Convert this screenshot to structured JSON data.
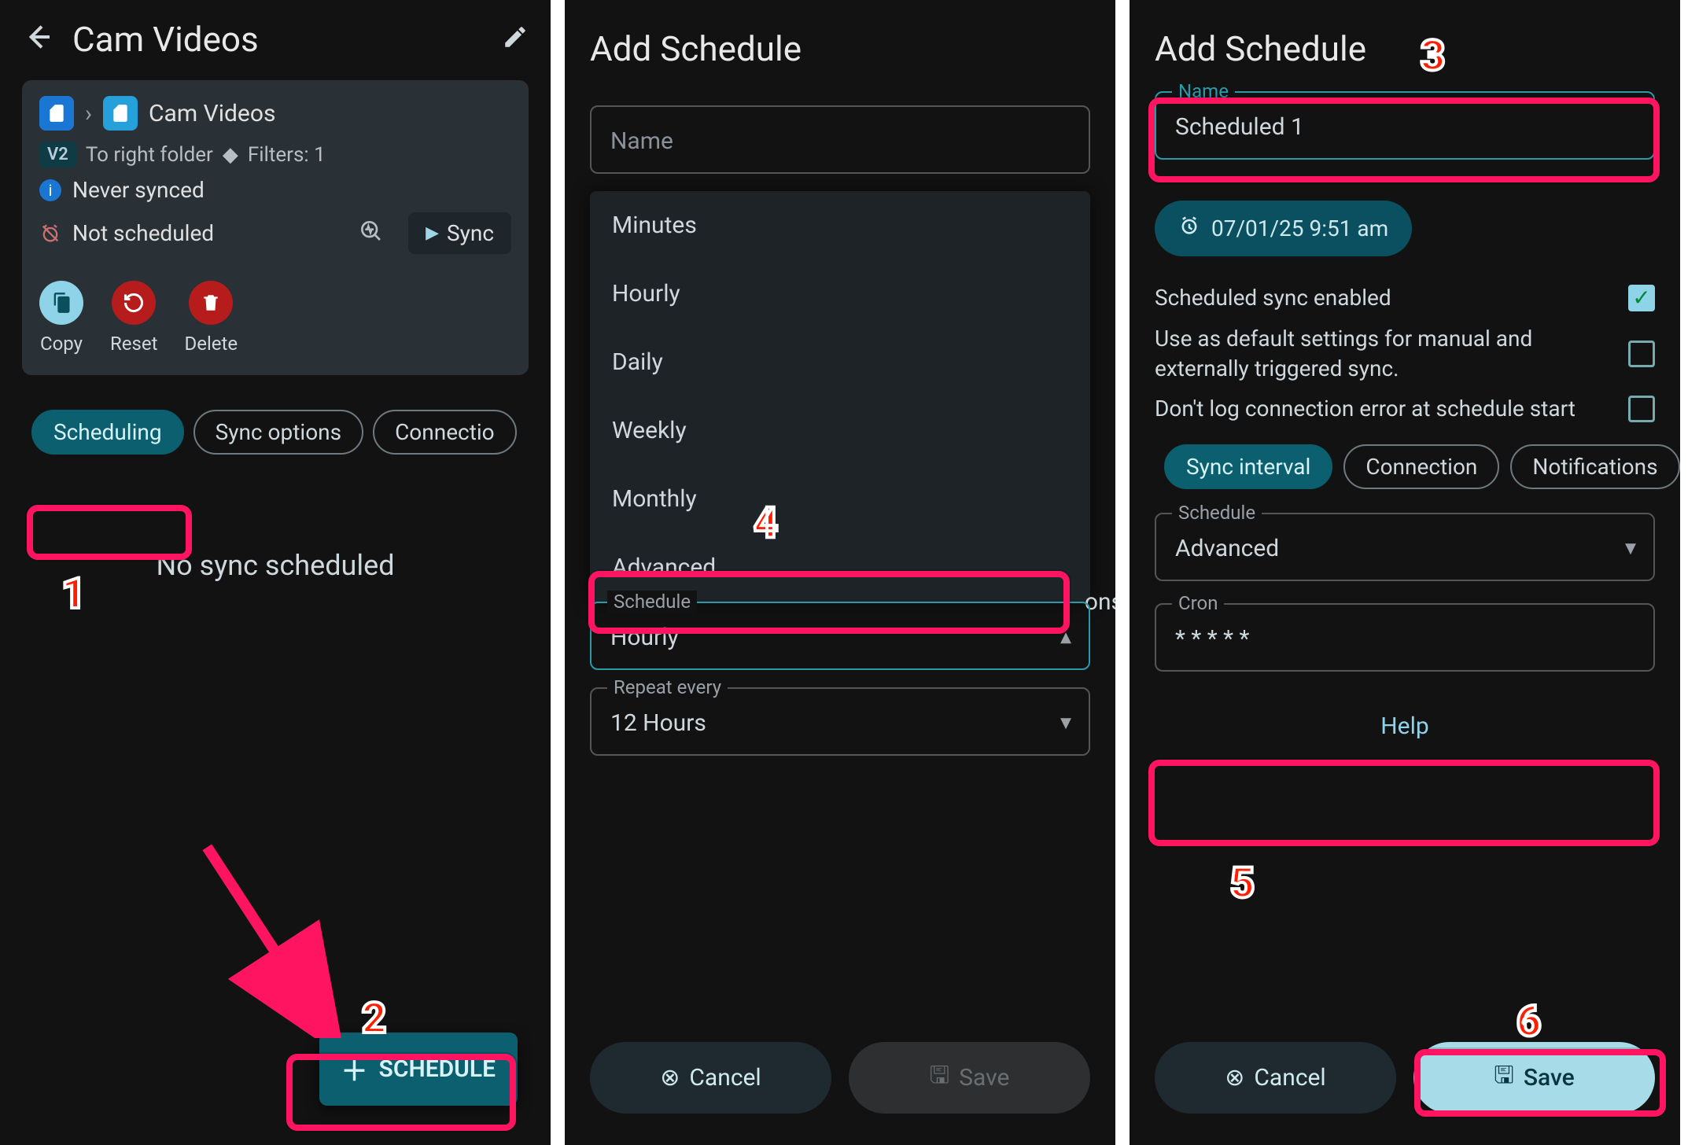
{
  "screen1": {
    "page_title": "Cam Videos",
    "breadcrumb_target": "Cam Videos",
    "v2_badge": "V2",
    "direction_text": "To right folder",
    "filters_text": "Filters: 1",
    "status_never": "Never synced",
    "status_notscheduled": "Not scheduled",
    "sync_button": "Sync",
    "actions": {
      "copy": "Copy",
      "reset": "Reset",
      "delete": "Delete"
    },
    "chips": {
      "scheduling": "Scheduling",
      "sync_options": "Sync options",
      "connections": "Connectio"
    },
    "empty": "No sync scheduled",
    "fab": "SCHEDULE"
  },
  "screen2": {
    "title": "Add Schedule",
    "name_placeholder": "Name",
    "menu": [
      "Minutes",
      "Hourly",
      "Daily",
      "Weekly",
      "Monthly",
      "Advanced"
    ],
    "schedule_label": "Schedule",
    "schedule_value": "Hourly",
    "repeat_label": "Repeat every",
    "repeat_value": "12 Hours",
    "partial_tab": "ons",
    "cancel": "Cancel",
    "save": "Save"
  },
  "screen3": {
    "title": "Add Schedule",
    "name_label": "Name",
    "name_value": "Scheduled 1",
    "datetime": "07/01/25 9:51 am",
    "toggle_enabled": "Scheduled sync enabled",
    "toggle_default": "Use as default settings for manual and externally triggered sync.",
    "toggle_noerr": "Don't log connection error at schedule start",
    "chips": {
      "interval": "Sync interval",
      "connection": "Connection",
      "notifications": "Notifications"
    },
    "schedule_label": "Schedule",
    "schedule_value": "Advanced",
    "cron_label": "Cron",
    "cron_value": "* * * * *",
    "help": "Help",
    "cancel": "Cancel",
    "save": "Save"
  },
  "annotations": {
    "n1": "1",
    "n2": "2",
    "n3": "3",
    "n4": "4",
    "n5": "5",
    "n6": "6"
  },
  "colors": {
    "accent_teal": "#0b5f6e",
    "highlight": "#ff1461",
    "bg": "#121212"
  }
}
